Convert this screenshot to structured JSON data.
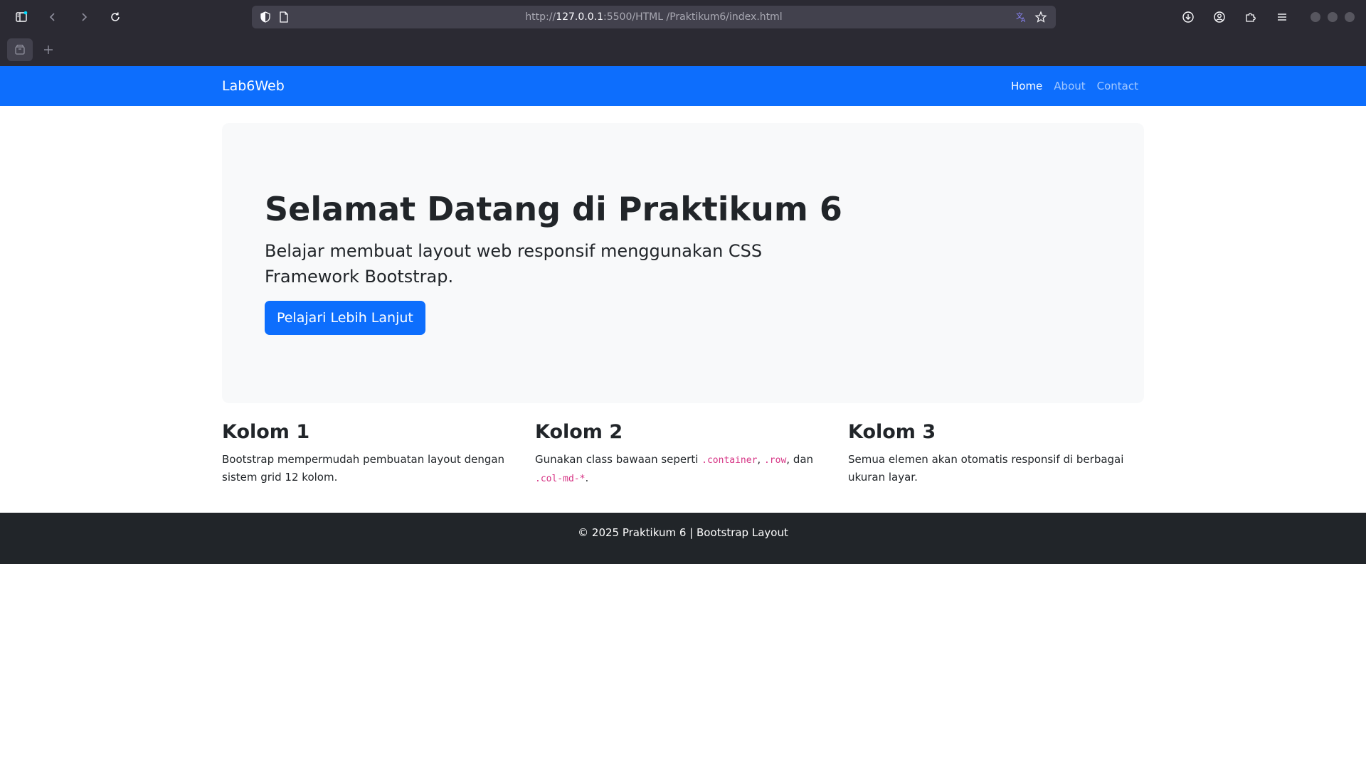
{
  "browser": {
    "url_prefix": "http://",
    "url_host": "127.0.0.1",
    "url_rest": ":5500/HTML /Praktikum6/index.html",
    "icons": [
      "sidebar-icon",
      "back-icon",
      "forward-icon",
      "reload-icon",
      "shield-icon",
      "page-icon",
      "translate-icon",
      "bookmark-star-icon",
      "download-icon",
      "account-icon",
      "extensions-icon",
      "menu-icon",
      "tab-icon",
      "new-tab-icon"
    ]
  },
  "navbar": {
    "brand": "Lab6Web",
    "links": [
      {
        "label": "Home",
        "active": true
      },
      {
        "label": "About",
        "active": false
      },
      {
        "label": "Contact",
        "active": false
      }
    ],
    "bg_color": "#0d6efd"
  },
  "hero": {
    "title": "Selamat Datang di Praktikum 6",
    "lead": "Belajar membuat layout web responsif menggunakan CSS Framework Bootstrap.",
    "button_label": "Pelajari Lebih Lanjut"
  },
  "columns": [
    {
      "title": "Kolom 1",
      "text": "Bootstrap mempermudah pembuatan layout dengan sistem grid 12 kolom."
    },
    {
      "title": "Kolom 2",
      "text_before": "Gunakan class bawaan seperti ",
      "code1": ".container",
      "sep1": ", ",
      "code2": ".row",
      "sep2": ", dan ",
      "code3": ".col-md-*",
      "text_after": "."
    },
    {
      "title": "Kolom 3",
      "text": "Semua elemen akan otomatis responsif di berbagai ukuran layar."
    }
  ],
  "footer": {
    "text": "© 2025 Praktikum 6 | Bootstrap Layout"
  }
}
